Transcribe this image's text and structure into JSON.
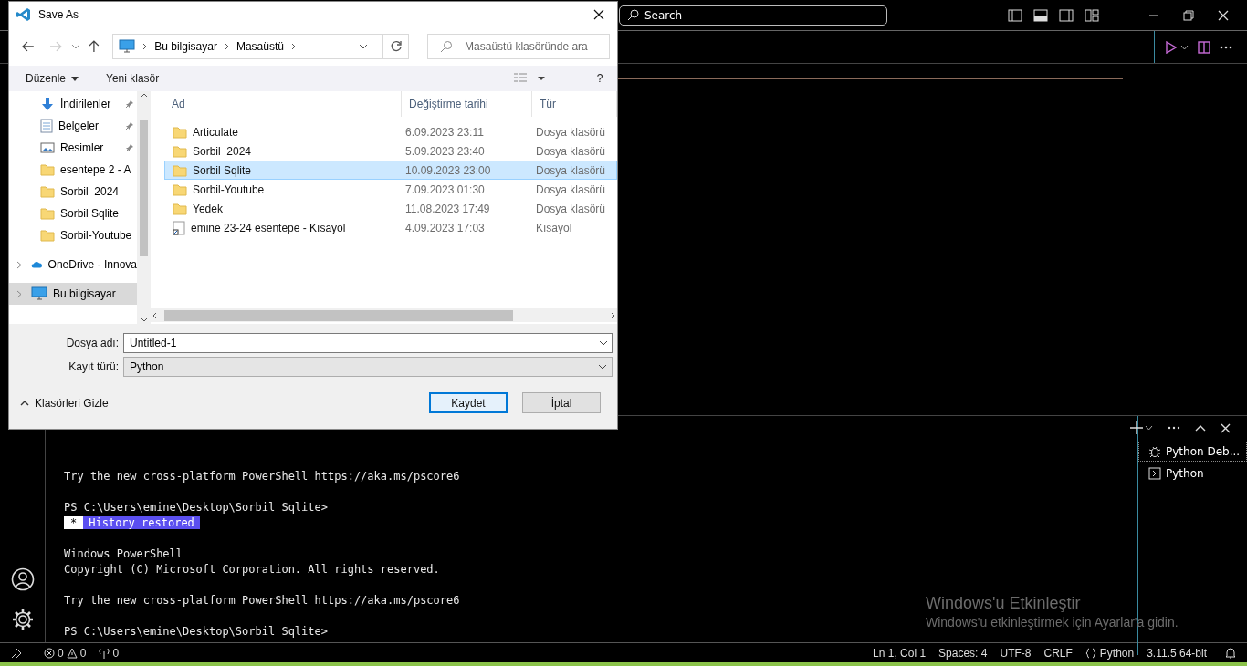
{
  "title_bar": {
    "search": "Search"
  },
  "dialog": {
    "title": "Save As",
    "address": [
      "Bu bilgisayar",
      "Masaüstü"
    ],
    "search": {
      "placeholder": "Masaüstü klasöründe ara"
    },
    "help": "?",
    "toolbar": [
      {
        "label": "Düzenle",
        "kind": "menu"
      },
      {
        "label": "Yeni klasör",
        "kind": "button"
      }
    ],
    "nav_items": [
      {
        "label": "İndirilenler",
        "kind": "download",
        "pinned": true,
        "selected": false
      },
      {
        "label": "Belgeler",
        "kind": "document",
        "pinned": true,
        "selected": false
      },
      {
        "label": "Resimler",
        "kind": "image",
        "pinned": true,
        "selected": false
      },
      {
        "label": "esentepe 2 - A",
        "kind": "folder",
        "pinned": false,
        "selected": false
      },
      {
        "label": "Sorbil  2024",
        "kind": "folder",
        "pinned": false,
        "selected": false
      },
      {
        "label": "Sorbil Sqlite",
        "kind": "folder",
        "pinned": false,
        "selected": false
      },
      {
        "label": "Sorbil-Youtube",
        "kind": "folder",
        "pinned": false,
        "selected": false
      },
      {
        "label": "OneDrive - Innova",
        "kind": "cloud",
        "pinned": false,
        "selected": false
      },
      {
        "label": "Bu bilgisayar",
        "kind": "pc",
        "pinned": false,
        "selected": true
      }
    ],
    "columns": [
      "Ad",
      "Değiştirme tarihi",
      "Tür"
    ],
    "files": [
      {
        "name": "Articulate",
        "modified": "6.09.2023 23:11",
        "type": "Dosya klasörü",
        "kind": "folder",
        "selected": false
      },
      {
        "name": "Sorbil  2024",
        "modified": "5.09.2023 23:40",
        "type": "Dosya klasörü",
        "kind": "folder",
        "selected": false
      },
      {
        "name": "Sorbil Sqlite",
        "modified": "10.09.2023 23:00",
        "type": "Dosya klasörü",
        "kind": "folder",
        "selected": true
      },
      {
        "name": "Sorbil-Youtube",
        "modified": "7.09.2023 01:30",
        "type": "Dosya klasörü",
        "kind": "folder",
        "selected": false
      },
      {
        "name": "Yedek",
        "modified": "11.08.2023 17:49",
        "type": "Dosya klasörü",
        "kind": "folder",
        "selected": false
      },
      {
        "name": "emine 23-24 esentepe - Kısayol",
        "modified": "4.09.2023 17:03",
        "type": "Kısayol",
        "kind": "shortcut",
        "selected": false
      }
    ],
    "file_name": {
      "label": "Dosya adı:",
      "value": "Untitled-1"
    },
    "save_type": {
      "label": "Kayıt türü:",
      "value": "Python"
    },
    "hide_folders": "Klasörleri Gizle",
    "buttons": [
      {
        "label": "Kaydet",
        "default": true
      },
      {
        "label": "İptal",
        "default": false
      }
    ]
  },
  "terminal": {
    "blocks": [
      [
        {
          "kind": "text",
          "text": "Try the new cross-platform PowerShell https://aka.ms/pscore6"
        }
      ],
      [
        {
          "kind": "text",
          "text": "PS C:\\Users\\emine\\Desktop\\Sorbil Sqlite>"
        },
        {
          "kind": "badge",
          "mark": "*",
          "text": "History restored"
        }
      ],
      [
        {
          "kind": "text",
          "text": "Windows PowerShell"
        },
        {
          "kind": "text",
          "text": "Copyright (C) Microsoft Corporation. All rights reserved."
        }
      ],
      [
        {
          "kind": "text",
          "text": "Try the new cross-platform PowerShell https://aka.ms/pscore6"
        }
      ],
      [
        {
          "kind": "text",
          "text": "PS C:\\Users\\emine\\Desktop\\Sorbil Sqlite>"
        }
      ]
    ]
  },
  "terminal_list": [
    {
      "label": "Python Deb...",
      "kind": "debug",
      "selected": true
    },
    {
      "label": "Python",
      "kind": "shell",
      "selected": false
    }
  ],
  "activation_notice": {
    "title": "Windows'u Etkinleştir",
    "text": "Windows'u etkinleştirmek için Ayarlar'a gidin."
  },
  "status_bar": {
    "errors": "0",
    "warnings": "0",
    "ports": "0",
    "items": [
      {
        "label": "Ln 1, Col 1",
        "kind": "text"
      },
      {
        "label": "Spaces: 4",
        "kind": "text"
      },
      {
        "label": "UTF-8",
        "kind": "text"
      },
      {
        "label": "CRLF",
        "kind": "text"
      },
      {
        "label": "Python",
        "kind": "language"
      },
      {
        "label": "3.11.5 64-bit",
        "kind": "text"
      }
    ]
  }
}
